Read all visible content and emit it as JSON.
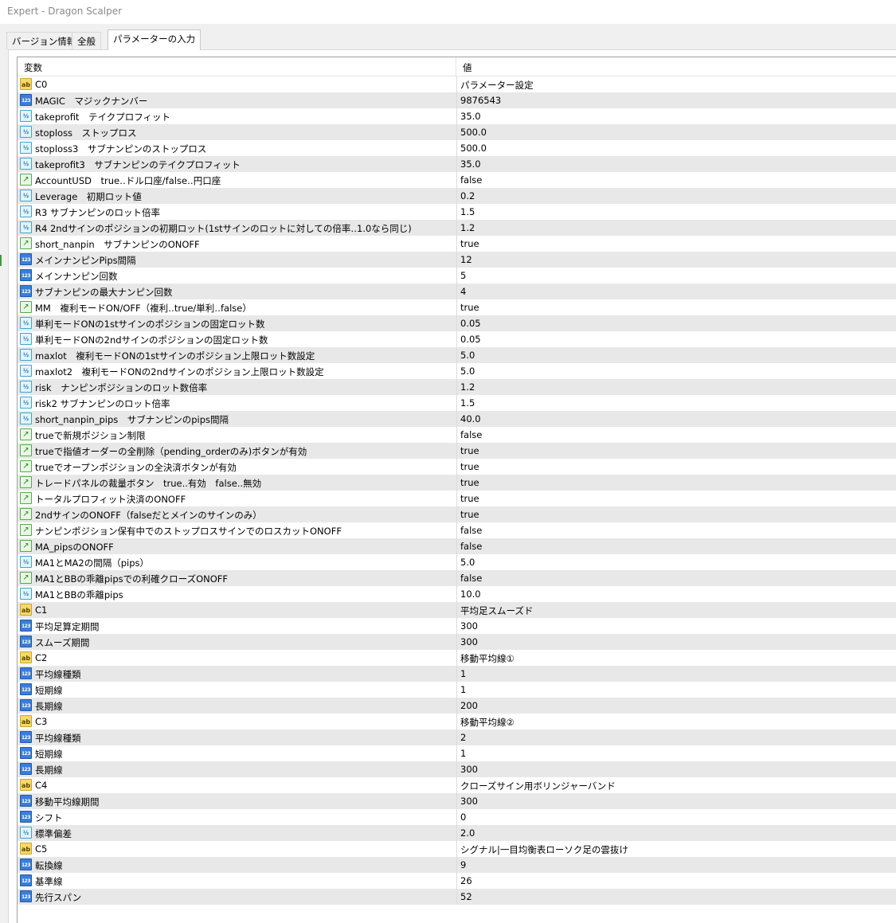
{
  "window": {
    "title": "Expert - Dragon Scalper"
  },
  "tabs": [
    {
      "label": "バージョン情報"
    },
    {
      "label": "全般"
    },
    {
      "label": "パラメーターの入力"
    }
  ],
  "table": {
    "headers": {
      "name": "変数",
      "value": "値"
    },
    "rows": [
      {
        "type": "string",
        "icon": "string-type-icon",
        "name": "C0",
        "value": "パラメーター設定"
      },
      {
        "type": "int",
        "icon": "integer-type-icon",
        "name": "MAGIC　マジックナンバー",
        "value": "9876543"
      },
      {
        "type": "double",
        "icon": "double-type-icon",
        "name": "takeprofit　テイクプロフィット",
        "value": "35.0"
      },
      {
        "type": "double",
        "icon": "double-type-icon",
        "name": "stoploss　ストップロス",
        "value": "500.0"
      },
      {
        "type": "double",
        "icon": "double-type-icon",
        "name": "stoploss3　サブナンピンのストップロス",
        "value": "500.0"
      },
      {
        "type": "double",
        "icon": "double-type-icon",
        "name": "takeprofit3　サブナンピンのテイクプロフィット",
        "value": "35.0"
      },
      {
        "type": "bool",
        "icon": "boolean-type-icon",
        "name": "AccountUSD　true‥ドル口座/false‥円口座",
        "value": "false"
      },
      {
        "type": "double",
        "icon": "double-type-icon",
        "name": "Leverage　初期ロット値",
        "value": "0.2"
      },
      {
        "type": "double",
        "icon": "double-type-icon",
        "name": "R3 サブナンピンのロット倍率",
        "value": "1.5"
      },
      {
        "type": "double",
        "icon": "double-type-icon",
        "name": "R4 2ndサインのポジションの初期ロット(1stサインのロットに対しての倍率‥1.0なら同じ)",
        "value": "1.2"
      },
      {
        "type": "bool",
        "icon": "boolean-type-icon",
        "name": "short_nanpin　サブナンピンのONOFF",
        "value": "true"
      },
      {
        "type": "int",
        "icon": "integer-type-icon",
        "name": "メインナンピンPips間隔",
        "value": "12"
      },
      {
        "type": "int",
        "icon": "integer-type-icon",
        "name": "メインナンピン回数",
        "value": "5"
      },
      {
        "type": "int",
        "icon": "integer-type-icon",
        "name": "サブナンピンの最大ナンピン回数",
        "value": "4"
      },
      {
        "type": "bool",
        "icon": "boolean-type-icon",
        "name": "MM　複利モードON/OFF（複利‥true/単利‥false）",
        "value": "true"
      },
      {
        "type": "double",
        "icon": "double-type-icon",
        "name": "単利モードONの1stサインのポジションの固定ロット数",
        "value": "0.05"
      },
      {
        "type": "double",
        "icon": "double-type-icon",
        "name": "単利モードONの2ndサインのポジションの固定ロット数",
        "value": "0.05"
      },
      {
        "type": "double",
        "icon": "double-type-icon",
        "name": "maxlot　複利モードONの1stサインのポジション上限ロット数設定",
        "value": "5.0"
      },
      {
        "type": "double",
        "icon": "double-type-icon",
        "name": "maxlot2　複利モードONの2ndサインのポジション上限ロット数設定",
        "value": "5.0"
      },
      {
        "type": "double",
        "icon": "double-type-icon",
        "name": "risk　ナンピンポジションのロット数倍率",
        "value": "1.2"
      },
      {
        "type": "double",
        "icon": "double-type-icon",
        "name": "risk2 サブナンピンのロット倍率",
        "value": "1.5"
      },
      {
        "type": "double",
        "icon": "double-type-icon",
        "name": "short_nanpin_pips　サブナンピンのpips間隔",
        "value": "40.0"
      },
      {
        "type": "bool",
        "icon": "boolean-type-icon",
        "name": "trueで新規ポジション制限",
        "value": "false"
      },
      {
        "type": "bool",
        "icon": "boolean-type-icon",
        "name": "trueで指値オーダーの全削除（pending_orderのみ)ボタンが有効",
        "value": "true"
      },
      {
        "type": "bool",
        "icon": "boolean-type-icon",
        "name": "trueでオープンポジションの全決済ボタンが有効",
        "value": "true"
      },
      {
        "type": "bool",
        "icon": "boolean-type-icon",
        "name": "トレードパネルの裁量ボタン　true..有効　false..無効",
        "value": "true"
      },
      {
        "type": "bool",
        "icon": "boolean-type-icon",
        "name": "トータルプロフィット決済のONOFF",
        "value": "true"
      },
      {
        "type": "bool",
        "icon": "boolean-type-icon",
        "name": "2ndサインのONOFF（falseだとメインのサインのみ）",
        "value": "true"
      },
      {
        "type": "bool",
        "icon": "boolean-type-icon",
        "name": "ナンピンポジション保有中でのストップロスサインでのロスカットONOFF",
        "value": "false"
      },
      {
        "type": "bool",
        "icon": "boolean-type-icon",
        "name": "MA_pipsのONOFF",
        "value": "false"
      },
      {
        "type": "double",
        "icon": "double-type-icon",
        "name": "MA1とMA2の間隔（pips）",
        "value": "5.0"
      },
      {
        "type": "bool",
        "icon": "boolean-type-icon",
        "name": "MA1とBBの乖離pipsでの利確クローズONOFF",
        "value": "false"
      },
      {
        "type": "double",
        "icon": "double-type-icon",
        "name": "MA1とBBの乖離pips",
        "value": "10.0"
      },
      {
        "type": "string",
        "icon": "string-type-icon",
        "name": "C1",
        "value": "平均足スムーズド"
      },
      {
        "type": "int",
        "icon": "integer-type-icon",
        "name": "平均足算定期間",
        "value": "300"
      },
      {
        "type": "int",
        "icon": "integer-type-icon",
        "name": "スムーズ期間",
        "value": "300"
      },
      {
        "type": "string",
        "icon": "string-type-icon",
        "name": "C2",
        "value": "移動平均線①"
      },
      {
        "type": "int",
        "icon": "integer-type-icon",
        "name": "平均線種類",
        "value": "1"
      },
      {
        "type": "int",
        "icon": "integer-type-icon",
        "name": "短期線",
        "value": "1"
      },
      {
        "type": "int",
        "icon": "integer-type-icon",
        "name": "長期線",
        "value": "200"
      },
      {
        "type": "string",
        "icon": "string-type-icon",
        "name": "C3",
        "value": "移動平均線②"
      },
      {
        "type": "int",
        "icon": "integer-type-icon",
        "name": "平均線種類",
        "value": "2"
      },
      {
        "type": "int",
        "icon": "integer-type-icon",
        "name": "短期線",
        "value": "1"
      },
      {
        "type": "int",
        "icon": "integer-type-icon",
        "name": "長期線",
        "value": "300"
      },
      {
        "type": "string",
        "icon": "string-type-icon",
        "name": "C4",
        "value": "クローズサイン用ボリンジャーバンド"
      },
      {
        "type": "int",
        "icon": "integer-type-icon",
        "name": "移動平均線期間",
        "value": "300"
      },
      {
        "type": "int",
        "icon": "integer-type-icon",
        "name": "シフト",
        "value": "0"
      },
      {
        "type": "double",
        "icon": "double-type-icon",
        "name": "標準偏差",
        "value": "2.0"
      },
      {
        "type": "string",
        "icon": "string-type-icon",
        "name": "C5",
        "value": "シグナル|一目均衡表ローソク足の雲抜け"
      },
      {
        "type": "int",
        "icon": "integer-type-icon",
        "name": "転換線",
        "value": "9"
      },
      {
        "type": "int",
        "icon": "integer-type-icon",
        "name": "基準線",
        "value": "26"
      },
      {
        "type": "int",
        "icon": "integer-type-icon",
        "name": "先行スパン",
        "value": "52"
      }
    ]
  },
  "icon_glyphs": {
    "string": "ab",
    "int": "123",
    "double": "½",
    "bool": "↗"
  }
}
